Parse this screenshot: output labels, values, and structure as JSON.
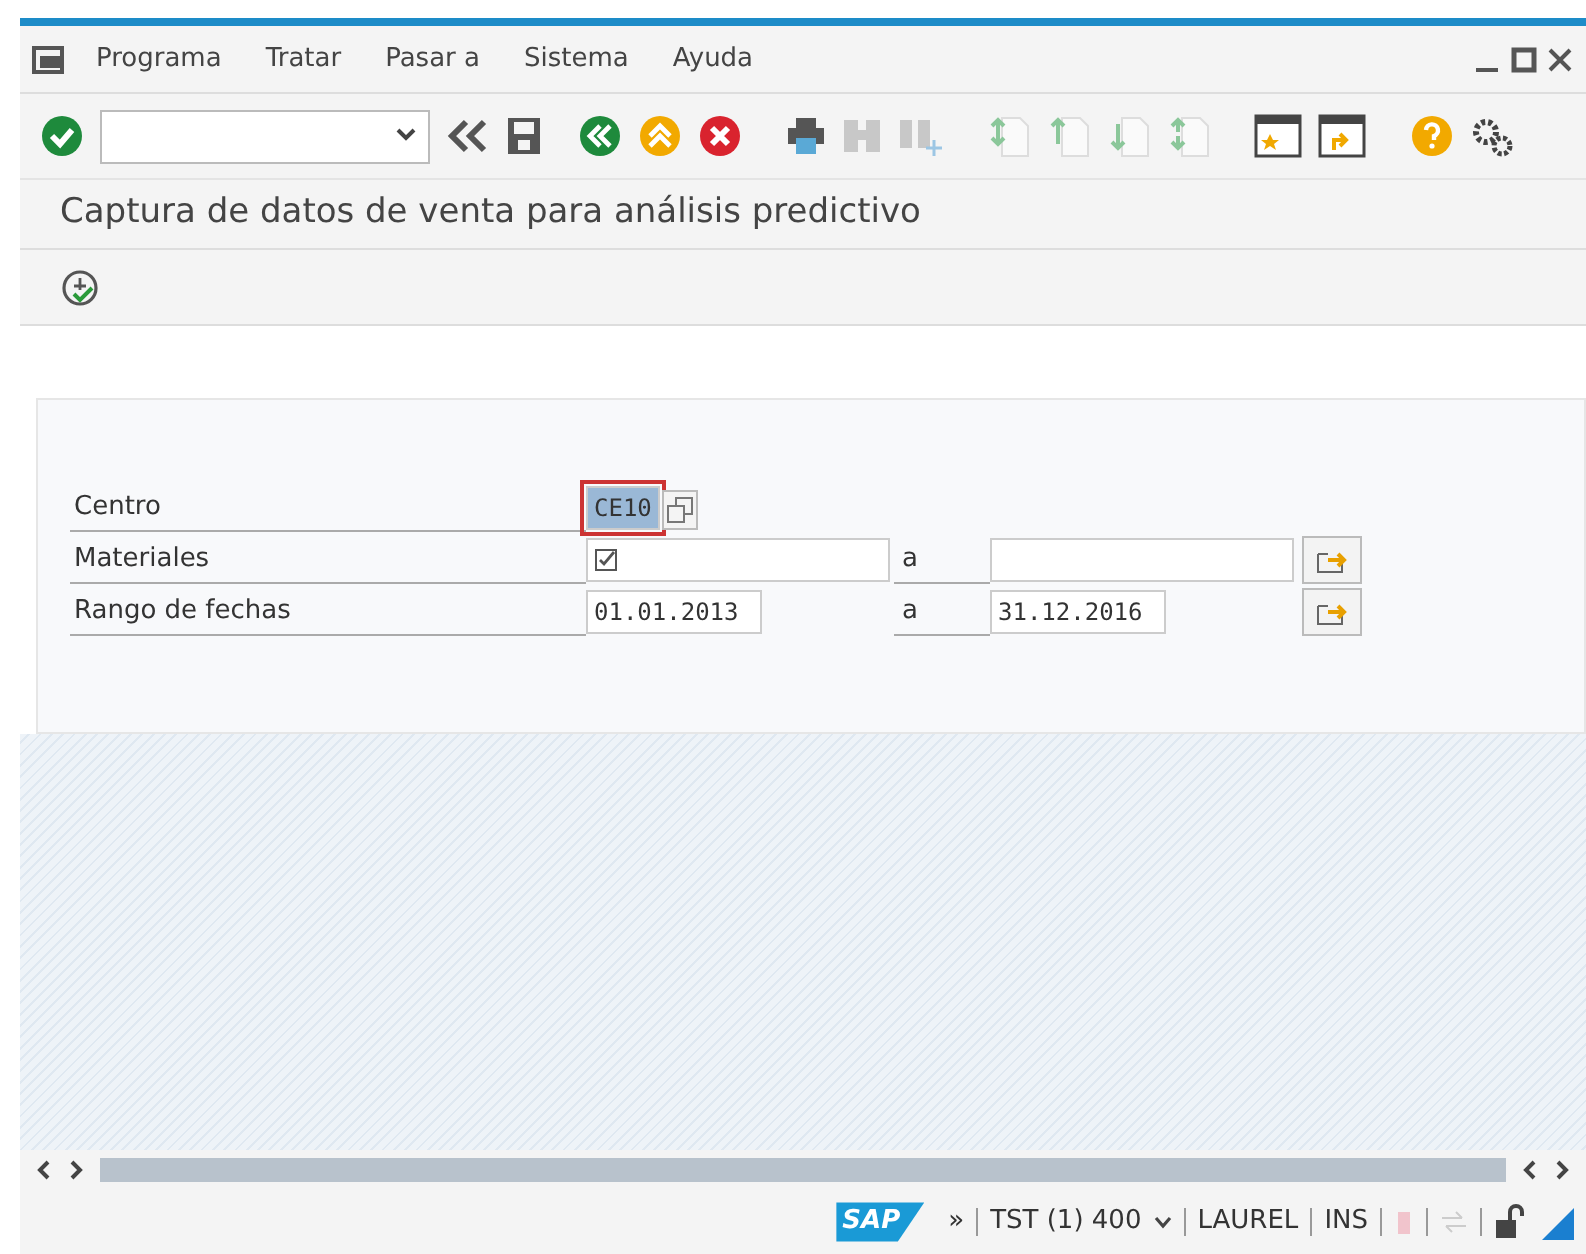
{
  "menu": [
    {
      "label": "Programa"
    },
    {
      "label": "Tratar"
    },
    {
      "label": "Pasar a"
    },
    {
      "label": "Sistema"
    },
    {
      "label": "Ayuda"
    }
  ],
  "title": "Captura de datos de venta para análisis predictivo",
  "fields": [
    {
      "kind": "single",
      "label": "Centro",
      "value": "CE10",
      "focused": true
    },
    {
      "kind": "range",
      "label": "Materiales",
      "checkmark": true,
      "to_label": "a"
    },
    {
      "kind": "range",
      "label": "Rango de fechas",
      "value": "01.01.2013",
      "to_label": "a",
      "to_value": "31.12.2016"
    }
  ],
  "status_bar": {
    "expand": "»",
    "system": "TST (1) 400",
    "user": "LAUREL",
    "mode": "INS"
  },
  "logo": "SAP"
}
